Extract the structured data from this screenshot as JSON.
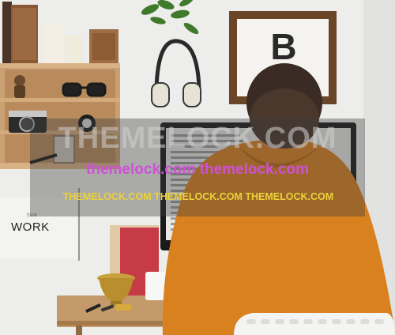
{
  "scene": {
    "frame_letter": "B",
    "poster_small_text": "think",
    "poster_text": "WORK"
  },
  "watermark": {
    "big": "THEMELOCK.COM",
    "pink": "themelock.com themelock.com",
    "yellow": "THEMELOCK.COM THEMELOCK.COM THEMELOCK.COM"
  }
}
